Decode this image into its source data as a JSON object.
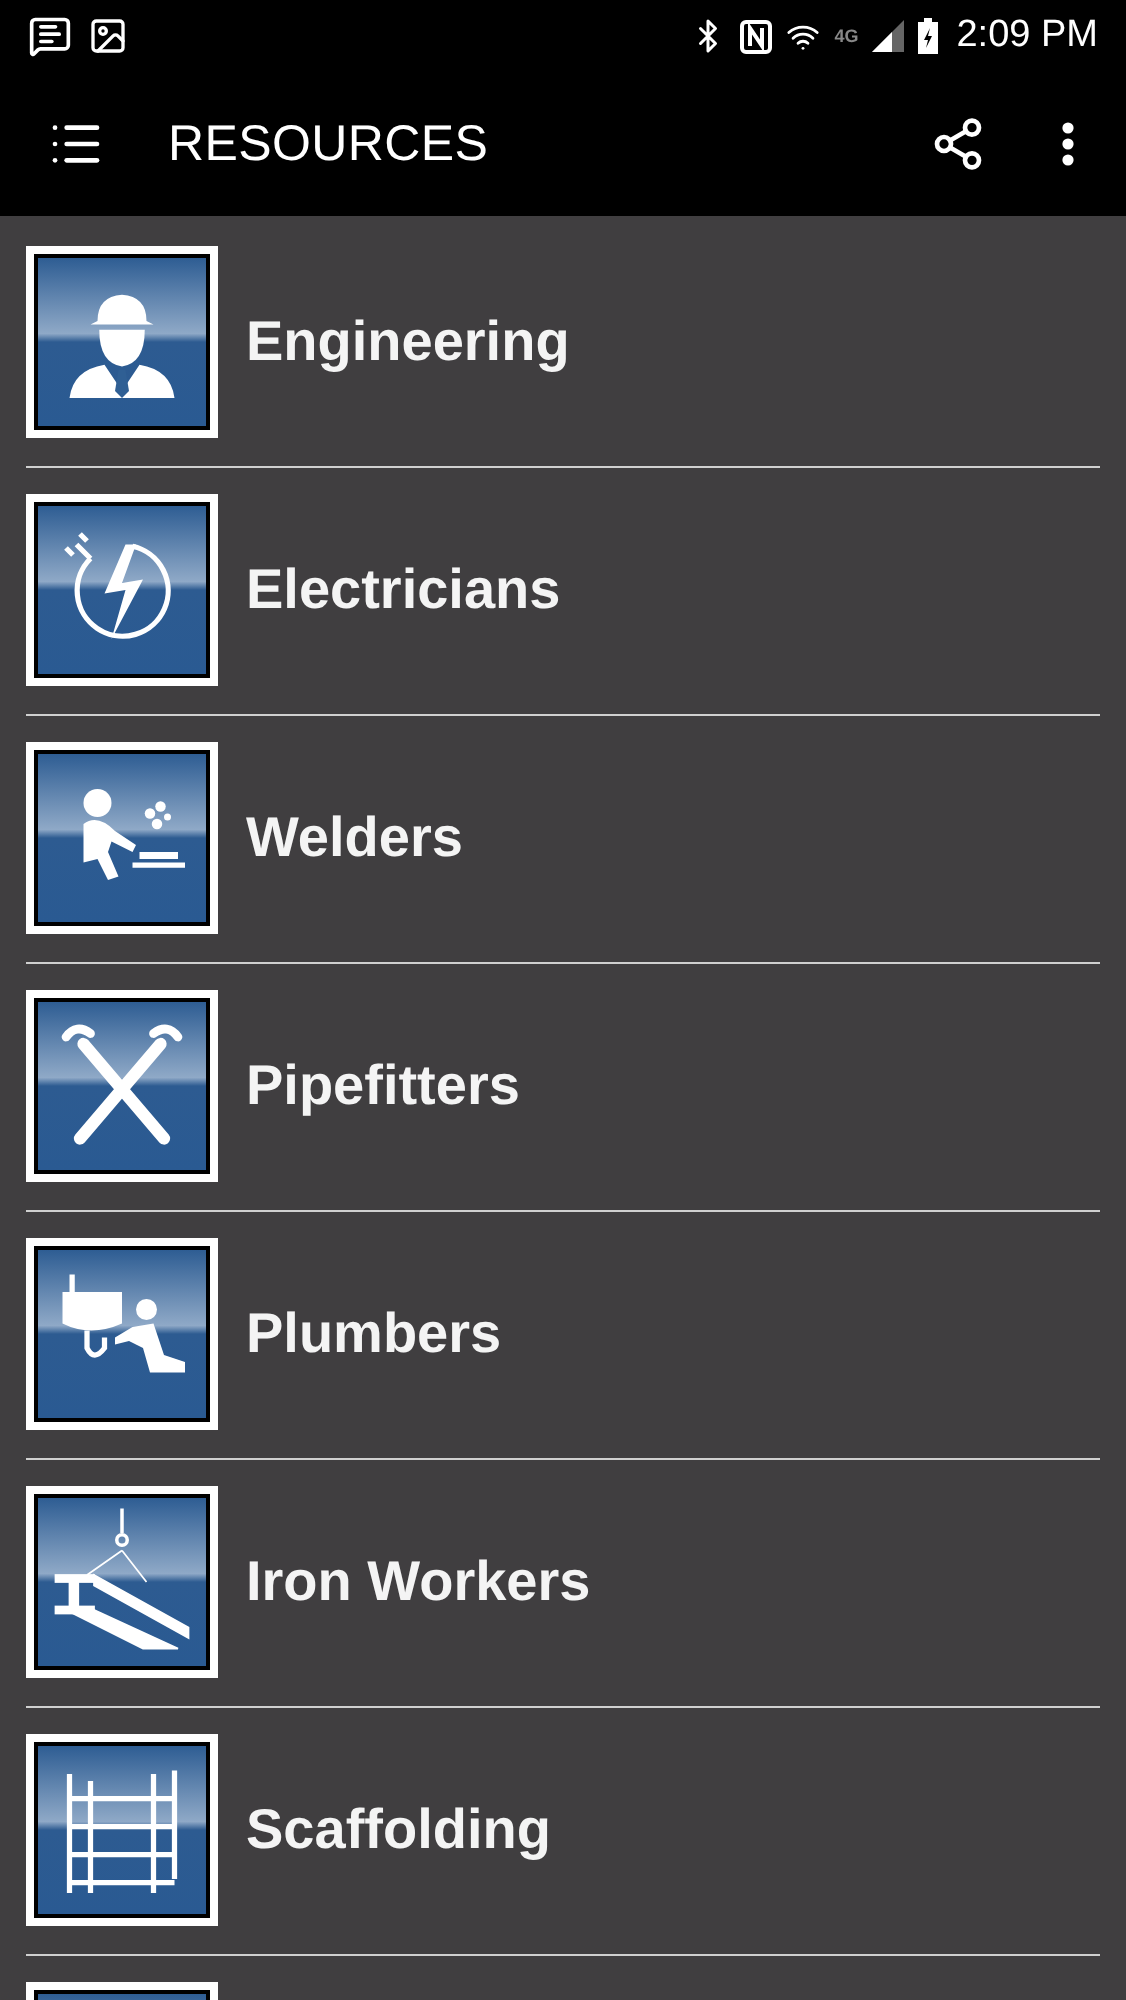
{
  "status_bar": {
    "network": "4G",
    "time": "2:09 PM"
  },
  "app_bar": {
    "title": "RESOURCES"
  },
  "items": [
    {
      "kind": "resource",
      "label": "Engineering"
    },
    {
      "kind": "resource",
      "label": "Electricians"
    },
    {
      "kind": "resource",
      "label": "Welders"
    },
    {
      "kind": "resource",
      "label": "Pipefitters"
    },
    {
      "kind": "resource",
      "label": "Plumbers"
    },
    {
      "kind": "resource",
      "label": "Iron Workers"
    },
    {
      "kind": "resource",
      "label": "Scaffolding"
    },
    {
      "kind": "cut-off"
    }
  ]
}
